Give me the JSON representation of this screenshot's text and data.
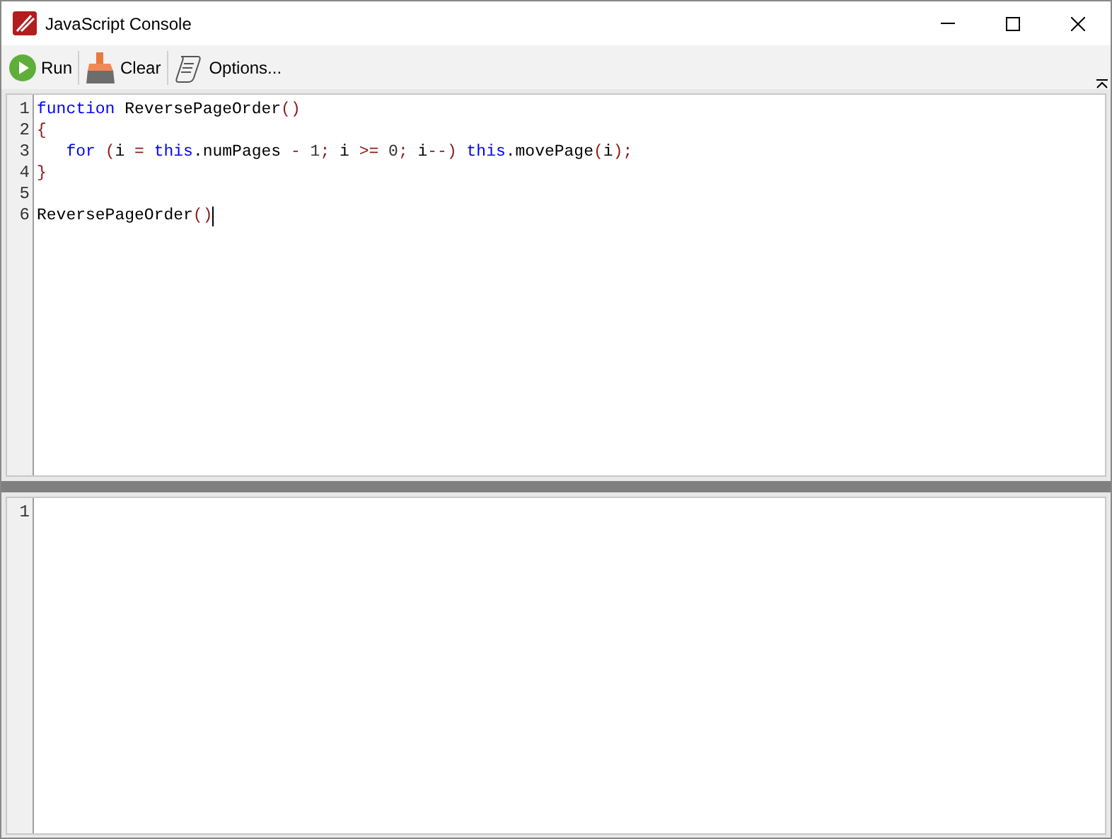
{
  "window": {
    "title": "JavaScript Console"
  },
  "toolbar": [
    {
      "kind": "run",
      "label": "Run"
    },
    {
      "kind": "clear",
      "label": "Clear"
    },
    {
      "kind": "options",
      "label": "Options..."
    }
  ],
  "editor": {
    "lines": [
      {
        "number": "1",
        "cursor": false,
        "tokens": [
          {
            "kind": "keyword",
            "text": "function"
          },
          {
            "kind": "text",
            "text": " ReversePageOrder"
          },
          {
            "kind": "op",
            "text": "()"
          }
        ]
      },
      {
        "number": "2",
        "cursor": false,
        "tokens": [
          {
            "kind": "op",
            "text": "{"
          }
        ]
      },
      {
        "number": "3",
        "cursor": false,
        "tokens": [
          {
            "kind": "keyword",
            "text": "   for "
          },
          {
            "kind": "op",
            "text": "("
          },
          {
            "kind": "text",
            "text": "i "
          },
          {
            "kind": "op",
            "text": "= "
          },
          {
            "kind": "keyword",
            "text": "this"
          },
          {
            "kind": "text",
            "text": ".numPages "
          },
          {
            "kind": "op",
            "text": "- "
          },
          {
            "kind": "number",
            "text": "1"
          },
          {
            "kind": "op",
            "text": "; "
          },
          {
            "kind": "text",
            "text": "i "
          },
          {
            "kind": "op",
            "text": ">= "
          },
          {
            "kind": "number",
            "text": "0"
          },
          {
            "kind": "op",
            "text": "; "
          },
          {
            "kind": "text",
            "text": "i"
          },
          {
            "kind": "op",
            "text": "--) "
          },
          {
            "kind": "keyword",
            "text": "this"
          },
          {
            "kind": "text",
            "text": ".movePage"
          },
          {
            "kind": "op",
            "text": "("
          },
          {
            "kind": "text",
            "text": "i"
          },
          {
            "kind": "op",
            "text": ");"
          }
        ]
      },
      {
        "number": "4",
        "cursor": false,
        "tokens": [
          {
            "kind": "op",
            "text": "}"
          }
        ]
      },
      {
        "number": "5",
        "cursor": false
      },
      {
        "number": "6",
        "cursor": true,
        "tokens": [
          {
            "kind": "text",
            "text": "ReversePageOrder"
          },
          {
            "kind": "op",
            "text": "()"
          }
        ]
      }
    ]
  },
  "output": {
    "lines": [
      {
        "number": "1"
      }
    ]
  }
}
